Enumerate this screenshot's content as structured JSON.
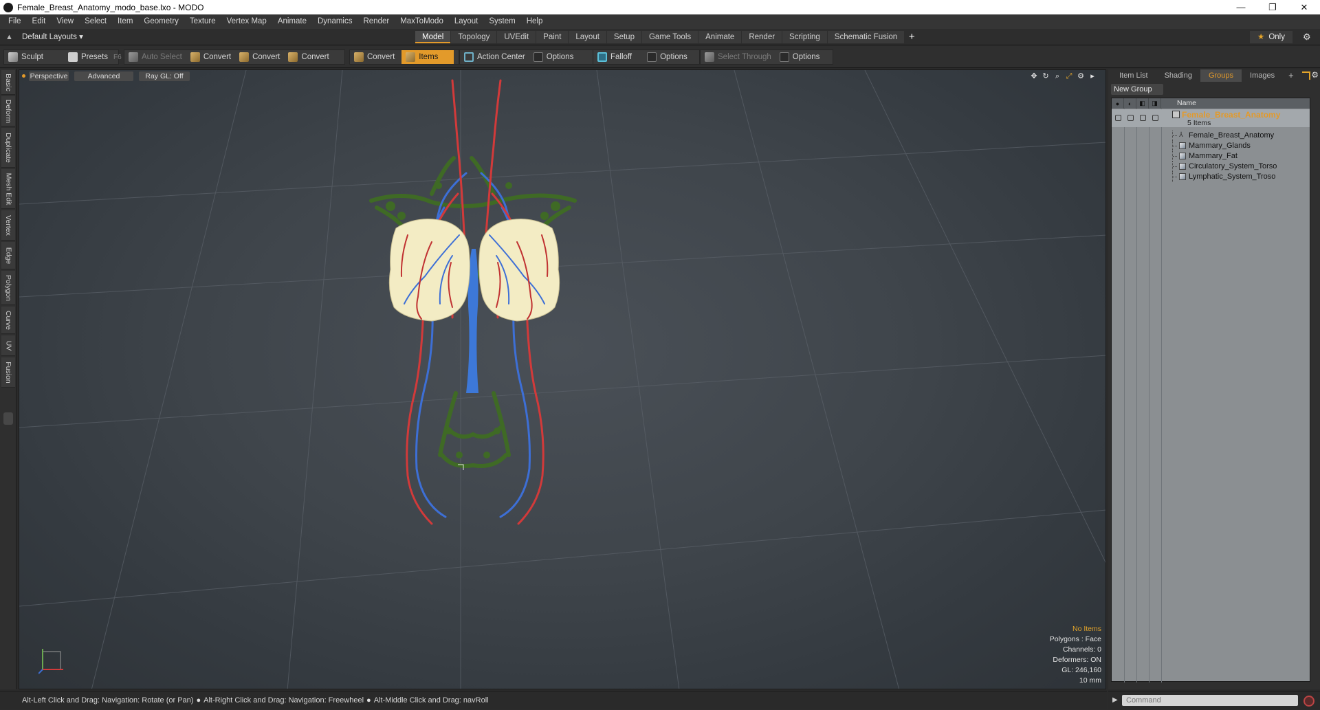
{
  "window": {
    "title": "Female_Breast_Anatomy_modo_base.lxo - MODO",
    "controls": [
      "—",
      "❐",
      "✕"
    ]
  },
  "menu": [
    "File",
    "Edit",
    "View",
    "Select",
    "Item",
    "Geometry",
    "Texture",
    "Vertex Map",
    "Animate",
    "Dynamics",
    "Render",
    "MaxToModo",
    "Layout",
    "System",
    "Help"
  ],
  "layoutbar": {
    "layout_select": "Default Layouts ▾",
    "tabs": [
      "Model",
      "Topology",
      "UVEdit",
      "Paint",
      "Layout",
      "Setup",
      "Game Tools",
      "Animate",
      "Render",
      "Scripting",
      "Schematic Fusion"
    ],
    "active_tab": "Model",
    "add_tab": "+",
    "only_label": "Only"
  },
  "toolbar": {
    "sculpt": "Sculpt",
    "presets": "Presets",
    "presets_key": "F6",
    "auto_select": "Auto Select",
    "convert1": "Convert",
    "convert2": "Convert",
    "convert3": "Convert",
    "convert4": "Convert",
    "items": "Items",
    "action_center": "Action Center",
    "options1": "Options",
    "falloff": "Falloff",
    "options2": "Options",
    "select_through": "Select Through",
    "options3": "Options"
  },
  "lefttabs": [
    "Basic",
    "Deform",
    "Duplicate",
    "Mesh Edit",
    "Vertex",
    "Edge",
    "Polygon",
    "Curve",
    "UV",
    "Fusion"
  ],
  "viewport": {
    "view_mode": "Perspective",
    "shading": "Advanced",
    "raygl": "Ray GL: Off",
    "info": {
      "selection": "No Items",
      "polygons": "Polygons : Face",
      "channels": "Channels: 0",
      "deformers": "Deformers: ON",
      "gl": "GL: 246,160",
      "scale": "10 mm"
    }
  },
  "rightpanel": {
    "tabs": [
      "Item List",
      "Shading",
      "Groups",
      "Images"
    ],
    "active_tab": "Groups",
    "add_tab": "+",
    "new_group": "New Group",
    "column_name": "Name",
    "root": {
      "name": "Female_Breast_Anatomy",
      "count": "5 Items"
    },
    "items": [
      {
        "label": "Female_Breast_Anatomy",
        "icon": "locator-icon"
      },
      {
        "label": "Mammary_Glands",
        "icon": "mesh-icon"
      },
      {
        "label": "Mammary_Fat",
        "icon": "mesh-icon"
      },
      {
        "label": "Circulatory_System_Torso",
        "icon": "mesh-icon"
      },
      {
        "label": "Lymphatic_System_Troso",
        "icon": "mesh-icon"
      }
    ]
  },
  "statusbar": {
    "hint1": "Alt-Left Click and Drag: Navigation: Rotate (or Pan)",
    "hint2": "Alt-Right Click and Drag: Navigation: Freewheel",
    "hint3": "Alt-Middle Click and Drag: navRoll"
  },
  "command": {
    "placeholder": "Command"
  },
  "colors": {
    "accent": "#e39a2a",
    "artery": "#d23a3a",
    "vein": "#3d6fd6",
    "lymph": "#3f6a25",
    "fat": "#f3ecc4"
  }
}
